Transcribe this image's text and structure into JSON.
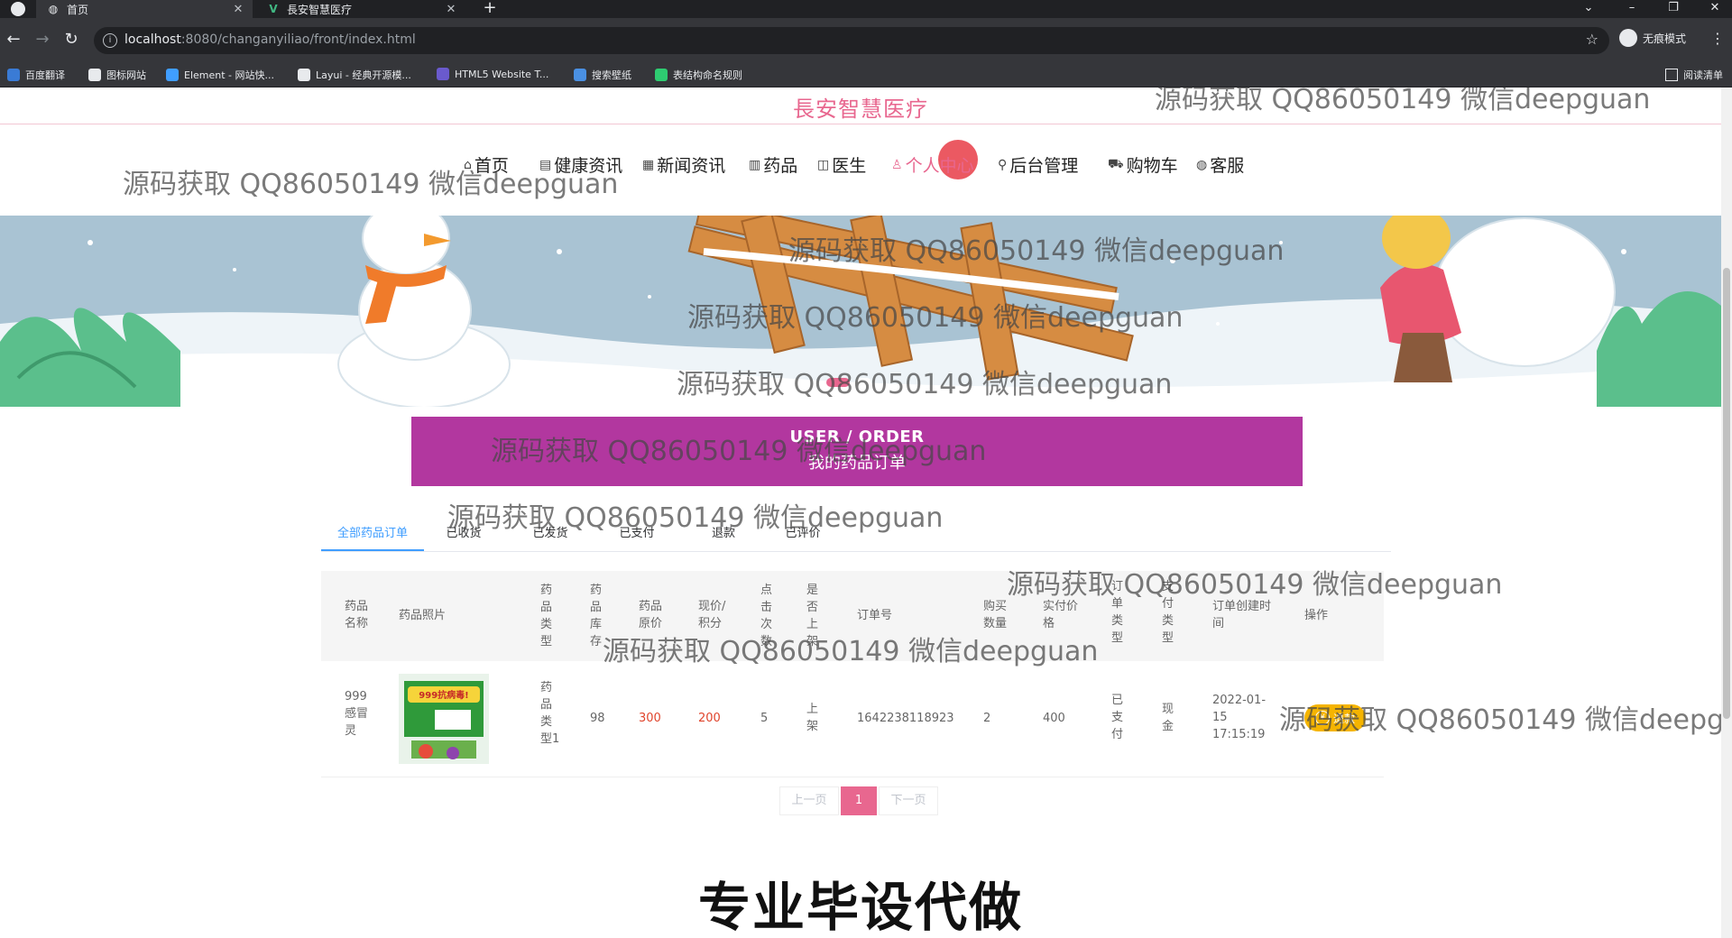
{
  "browser": {
    "tabs": [
      {
        "title": "首页",
        "active": true
      },
      {
        "title": "長安智慧医疗",
        "active": false
      }
    ],
    "new_tab": "+",
    "url_host": "localhost",
    "url_rest": ":8080/changanyiliao/front/index.html",
    "info_icon": "i",
    "star_icon": "☆",
    "profile_label": "无痕模式",
    "bookmarks": [
      {
        "label": "百度翻译",
        "color": "#3a7bd5"
      },
      {
        "label": "图标网站",
        "color": "#e8eaed"
      },
      {
        "label": "Element - 网站快...",
        "color": "#409eff"
      },
      {
        "label": "Layui - 经典开源模...",
        "color": "#e8eaed"
      },
      {
        "label": "HTML5 Website T...",
        "color": "#6a5acd"
      },
      {
        "label": "搜索壁纸",
        "color": "#4a90e2"
      },
      {
        "label": "表结构命名规则",
        "color": "#2ecc71"
      }
    ],
    "reading_list": "阅读清单"
  },
  "site": {
    "title": "長安智慧医疗",
    "brand_color": "#e8678f",
    "nav": [
      {
        "icon": "⌂",
        "label": "首页"
      },
      {
        "icon": "▤",
        "label": "健康资讯"
      },
      {
        "icon": "▦",
        "label": "新闻资讯"
      },
      {
        "icon": "▥",
        "label": "药品"
      },
      {
        "icon": "◫",
        "label": "医生"
      },
      {
        "icon": "♙",
        "label": "个人中心"
      },
      {
        "icon": "⚲",
        "label": "后台管理"
      },
      {
        "icon": "⛟",
        "label": "购物车"
      },
      {
        "icon": "◍",
        "label": "客服"
      }
    ],
    "active_nav": "个人中心"
  },
  "order_banner": {
    "en": "USER / ORDER",
    "zh": "我的药品订单",
    "color": "#b2379f"
  },
  "order_tabs": [
    "全部药品订单",
    "已收货",
    "已发货",
    "已支付",
    "退款",
    "已评价"
  ],
  "table": {
    "headers": [
      "药品\n名称",
      "药品照片",
      "药\n品\n类\n型",
      "药\n品\n库\n存",
      "药品\n原价",
      "现价/\n积分",
      "点\n击\n次\n数",
      "是\n否\n上\n架",
      "订单号",
      "购买\n数量",
      "实付价\n格",
      "订\n单\n类\n型",
      "支\n付\n类\n型",
      "订单创建时\n间",
      "操作"
    ],
    "rows": [
      {
        "name": "999\n感冒\n灵",
        "photo_text": "999抗病毒!",
        "type": "药\n品\n类\n型1",
        "stock": "98",
        "original_price": "300",
        "current_price": "200",
        "clicks": "5",
        "on_shelf": "上\n架",
        "order_no": "1642238118923",
        "quantity": "2",
        "paid": "400",
        "order_type": "已\n支\n付",
        "pay_type": "现\n金",
        "created": "2022-01-\n15\n17:15:19",
        "action": "退款"
      }
    ]
  },
  "pager": {
    "prev": "上一页",
    "current": "1",
    "next": "下一页"
  },
  "promo": "专业毕设代做",
  "watermark": "源码获取 QQ86050149 微信deepguan",
  "watermark_cut": "源码获取 QQ86050149 微信deepgu"
}
